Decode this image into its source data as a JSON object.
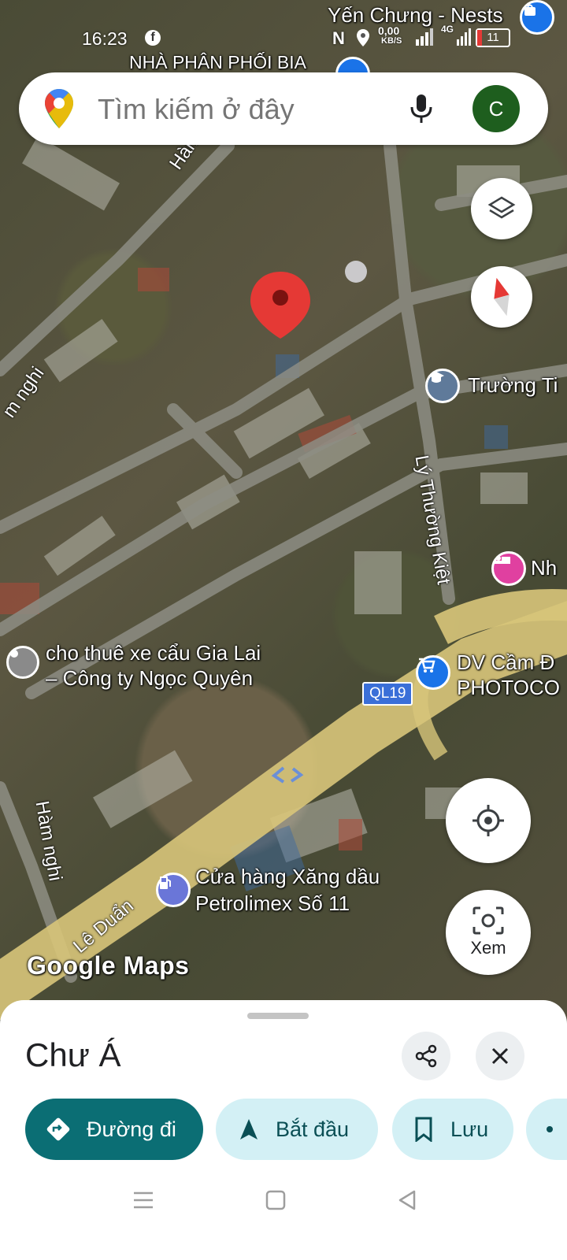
{
  "status_bar": {
    "time": "16:23",
    "net_speed": "0,00",
    "net_unit": "KB/S",
    "signal": "4G",
    "battery": "11"
  },
  "search": {
    "placeholder": "Tìm kiếm ở đây",
    "avatar_letter": "C"
  },
  "map": {
    "labels": {
      "yen_chung": "Yến Chưng - Nests",
      "nha_phan_phoi": "NHÀ PHÂN PHỐI BIA",
      "ham_nghi_top": "Hàm nghi",
      "ham_nghi_left": "m nghi",
      "ham_nghi_bottom": "Hàm nghi",
      "truong": "Trường Ti",
      "ly_thuong_kiet": "Lý Thường Kiệt",
      "nh": "Nh",
      "cho_thue_line1": "cho thuê xe cẩu Gia Lai",
      "cho_thue_line2": "– Công ty Ngọc Quyên",
      "dv_cam_line1": "DV Cầm Đ",
      "dv_cam_line2": "PHOTOCO",
      "ql19": "QL19",
      "le_duan": "Lê Duẩn",
      "cua_hang_line1": "Cửa hàng Xăng dầu",
      "cua_hang_line2": "Petrolimex Số 11",
      "watermark": "Google Maps"
    },
    "look_label": "Xem",
    "colors": {
      "pin": "#e53935",
      "highway": "#d9c77a",
      "road": "#8a8a80"
    }
  },
  "sheet": {
    "title": "Chư Á",
    "actions": {
      "directions": "Đường đi",
      "start": "Bắt đầu",
      "save": "Lưu"
    }
  }
}
